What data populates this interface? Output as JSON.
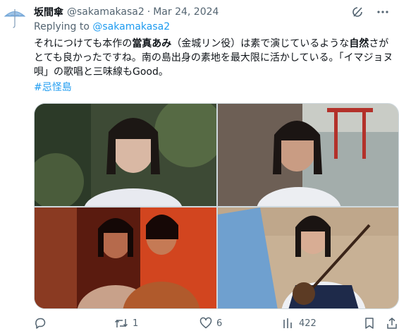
{
  "tweet": {
    "author": {
      "display_name": "坂間傘",
      "handle": "@sakamakasa2"
    },
    "separator": "·",
    "date": "Mar 24, 2024",
    "replying_prefix": "Replying to",
    "replying_to": "@sakamakasa2",
    "text_segments": [
      "それにつけても本作の",
      "當真あみ",
      "（金城リン役）は素で演じているような",
      "自然",
      "さがとても良かったですね。南の島出身の素地を最大限に活かしている。「イマジョヌ唄」の歌唱と三味線もGood。"
    ],
    "hashtag": "#忌怪島"
  },
  "actions": {
    "reply_count": "",
    "retweet_count": "1",
    "like_count": "6",
    "views_count": "422"
  },
  "icons": {
    "avatar": "umbrella-avatar",
    "header": [
      "grok-icon",
      "more-icon"
    ],
    "actions": [
      "reply-icon",
      "retweet-icon",
      "like-icon",
      "views-icon",
      "bookmark-icon",
      "share-icon"
    ]
  },
  "colors": {
    "link": "#1d9bf0",
    "secondary": "#536471",
    "text": "#0f1419"
  }
}
